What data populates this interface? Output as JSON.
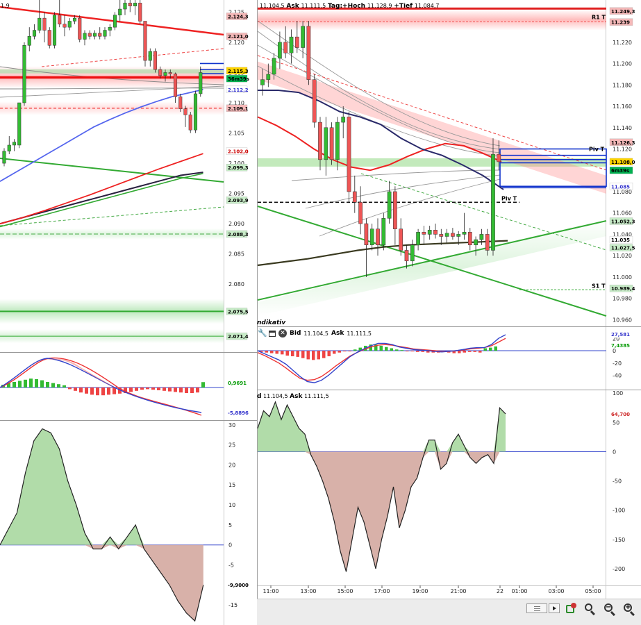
{
  "left_header": "1,9",
  "right_header": {
    "bid_value": "11.104,5",
    "ask_label": "Ask",
    "ask_value": "11.111,5",
    "tag_high_label": "Tag:+Hoch",
    "high_value": "11.128,9",
    "tag_low_label": "+Tief",
    "low_value": "11.084,7"
  },
  "indicator_header": {
    "indikativ": "ndikativ",
    "bid_label": "Bid",
    "bid_value": "11.104,5",
    "ask_label": "Ask",
    "ask_value": "11.111,5"
  },
  "osc_header": {
    "bid_fragment": "d",
    "bid_value": "11.104,5",
    "ask_label": "Ask",
    "ask_value": "11.111,5"
  },
  "chart_data": [
    {
      "type": "candlestick",
      "id": "left-price",
      "y_ticks": [
        "2.125",
        "2.120",
        "2.115",
        "2.110",
        "2.105",
        "2.100",
        "2.095",
        "2.090",
        "2.085",
        "2.080"
      ],
      "ylim": [
        2.069,
        2.127
      ],
      "tags": [
        {
          "text": "2.124,3",
          "value": 2.1243,
          "color": "#f4b8b8",
          "fg": "#000"
        },
        {
          "text": "2.121,0",
          "value": 2.121,
          "color": "#f4b8b8",
          "fg": "#000"
        },
        {
          "text": "2.115,3",
          "value": 2.1153,
          "color": "#ffd400",
          "fg": "#000"
        },
        {
          "text": "36m39s",
          "value": 2.114,
          "color": "#00b050",
          "fg": "#000"
        },
        {
          "text": "2.112,2",
          "value": 2.1122,
          "color": "#ffffff",
          "fg": "#3333cc"
        },
        {
          "text": "2.109,1",
          "value": 2.1091,
          "color": "#f4b8b8",
          "fg": "#000"
        },
        {
          "text": "2.102,0",
          "value": 2.102,
          "color": "#ffffff",
          "fg": "#cc0000"
        },
        {
          "text": "2.099,3",
          "value": 2.0993,
          "color": "#c8ecc8",
          "fg": "#000"
        },
        {
          "text": "2.093,9",
          "value": 2.0939,
          "color": "#c8ecc8",
          "fg": "#000"
        },
        {
          "text": "2.088,3",
          "value": 2.0883,
          "color": "#c8ecc8",
          "fg": "#000"
        },
        {
          "text": "2.075,5",
          "value": 2.0755,
          "color": "#c8ecc8",
          "fg": "#000"
        },
        {
          "text": "2.071,4",
          "value": 2.0714,
          "color": "#c8ecc8",
          "fg": "#000"
        }
      ],
      "candles": [
        [
          2.1,
          2.1025,
          2.0995,
          2.102
        ],
        [
          2.102,
          2.1045,
          2.1015,
          2.103
        ],
        [
          2.103,
          2.104,
          2.102,
          2.1035
        ],
        [
          2.103,
          2.106,
          2.1025,
          2.11
        ],
        [
          2.11,
          2.12,
          2.1095,
          2.1195
        ],
        [
          2.1195,
          2.1225,
          2.1185,
          2.121
        ],
        [
          2.121,
          2.123,
          2.1205,
          2.122
        ],
        [
          2.122,
          2.129,
          2.1215,
          2.124
        ],
        [
          2.124,
          2.125,
          2.12,
          2.122
        ],
        [
          2.122,
          2.1225,
          2.119,
          2.1195
        ],
        [
          2.1195,
          2.125,
          2.119,
          2.1245
        ],
        [
          2.1245,
          2.127,
          2.1225,
          2.123
        ],
        [
          2.123,
          2.1245,
          2.121,
          2.1225
        ],
        [
          2.1225,
          2.124,
          2.122,
          2.1235
        ],
        [
          2.1235,
          2.1245,
          2.123,
          2.124
        ],
        [
          2.124,
          2.1245,
          2.12,
          2.1205
        ],
        [
          2.1205,
          2.122,
          2.1195,
          2.1215
        ],
        [
          2.1215,
          2.122,
          2.1205,
          2.121
        ],
        [
          2.121,
          2.122,
          2.1205,
          2.1215
        ],
        [
          2.1215,
          2.1225,
          2.1205,
          2.121
        ],
        [
          2.121,
          2.1225,
          2.1205,
          2.122
        ],
        [
          2.122,
          2.123,
          2.121,
          2.1225
        ],
        [
          2.1225,
          2.125,
          2.122,
          2.1245
        ],
        [
          2.1245,
          2.127,
          2.1235,
          2.1255
        ],
        [
          2.1255,
          2.127,
          2.1245,
          2.1265
        ],
        [
          2.1265,
          2.127,
          2.125,
          2.126
        ],
        [
          2.126,
          2.127,
          2.1245,
          2.1265
        ],
        [
          2.1265,
          2.127,
          2.123,
          2.1235
        ],
        [
          2.1235,
          2.1235,
          2.116,
          2.117
        ],
        [
          2.117,
          2.119,
          2.116,
          2.1185
        ],
        [
          2.1185,
          2.119,
          2.115,
          2.1155
        ],
        [
          2.1155,
          2.116,
          2.114,
          2.1145
        ],
        [
          2.1145,
          2.1155,
          2.1135,
          2.115
        ],
        [
          2.115,
          2.1155,
          2.114,
          2.1148
        ],
        [
          2.1148,
          2.115,
          2.11,
          2.111
        ],
        [
          2.111,
          2.1115,
          2.1085,
          2.109
        ],
        [
          2.109,
          2.1095,
          2.106,
          2.108
        ],
        [
          2.108,
          2.1085,
          2.105,
          2.1055
        ],
        [
          2.1055,
          2.112,
          2.105,
          2.1115
        ],
        [
          2.1115,
          2.116,
          2.111,
          2.115
        ]
      ],
      "ma_blue": [
        2.097,
        2.0985,
        2.1,
        2.1015,
        2.103,
        2.1045,
        2.106,
        2.1072,
        2.1083,
        2.1093,
        2.1102,
        2.111,
        2.1116,
        2.1122
      ],
      "ma_red": [
        2.09,
        2.091,
        2.0922,
        2.0935,
        2.0948,
        2.0962,
        2.0976,
        2.099,
        2.1003,
        2.1016
      ],
      "ma_dark": [
        2.09,
        2.091,
        2.092,
        2.093,
        2.094,
        2.095,
        2.096,
        2.097,
        2.098,
        2.0985
      ],
      "ma_green": [
        2.0895,
        2.0905,
        2.0915,
        2.0925,
        2.0935,
        2.0945,
        2.0955,
        2.0965,
        2.0975,
        2.0983
      ]
    },
    {
      "type": "bar",
      "id": "left-macd",
      "tags": [
        {
          "text": "0,9691",
          "value": 0.9691,
          "color": "#ffffff",
          "fg": "#009900"
        },
        {
          "text": "-5,8896",
          "value": -5.8896,
          "color": "#ffffff",
          "fg": "#3333cc"
        }
      ],
      "values": [
        0.5,
        0.8,
        1.0,
        1.2,
        1.4,
        1.6,
        1.5,
        1.3,
        1.0,
        0.8,
        0.6,
        0.4,
        -0.3,
        -0.6,
        -0.9,
        -1.1,
        -1.3,
        -1.4,
        -1.4,
        -1.3,
        -1.2,
        -1.1,
        -1.0,
        -0.8,
        -0.6,
        -0.4,
        -0.3,
        -0.4,
        -0.5,
        -0.6,
        -0.7,
        -0.8,
        -0.9,
        -1.0,
        -1.0,
        -0.9,
        0.9691
      ]
    },
    {
      "type": "area",
      "id": "left-osc",
      "y_ticks": [
        "30",
        "25",
        "20",
        "15",
        "10",
        "5",
        "0",
        "-5",
        "-10",
        "-15"
      ],
      "ylim": [
        -20,
        31
      ],
      "tag": {
        "text": "-9,9000",
        "value": -9.9
      },
      "values": [
        0,
        4,
        8,
        18,
        26,
        29,
        28,
        24,
        16,
        10,
        3,
        -1,
        -1,
        2,
        -1,
        2,
        5,
        -1,
        -4,
        -7,
        -10,
        -14,
        -17,
        -19,
        -10
      ]
    },
    {
      "type": "candlestick",
      "id": "right-price",
      "y_ticks": [
        "11.220",
        "11.200",
        "11.180",
        "11.160",
        "11.140",
        "11.120",
        "11.100",
        "11.080",
        "11.060",
        "11.040",
        "11.020",
        "11.000",
        "10.980",
        "10.960"
      ],
      "ylim": [
        10.955,
        11.257
      ],
      "x_ticks": [
        "11:00",
        "13:00",
        "15:00",
        "17:00",
        "19:00",
        "21:00",
        "22",
        "01:00",
        "03:00",
        "05:00"
      ],
      "tags": [
        {
          "text": "11.249,3",
          "value": 11.2493,
          "color": "#f4b8b8",
          "fg": "#000"
        },
        {
          "text": "11.239",
          "value": 11.239,
          "color": "#f4b8b8",
          "fg": "#000"
        },
        {
          "text": "11.126,3",
          "value": 11.1263,
          "color": "#f4b8b8",
          "fg": "#000"
        },
        {
          "text": "11.108,0",
          "value": 11.108,
          "color": "#ffd400",
          "fg": "#000"
        },
        {
          "text": "6m39s",
          "value": 11.1,
          "color": "#00b050",
          "fg": "#000"
        },
        {
          "text": "11.085",
          "value": 11.085,
          "color": "#ffffff",
          "fg": "#3333cc"
        },
        {
          "text": "11.052,3",
          "value": 11.0523,
          "color": "#c8ecc8",
          "fg": "#000"
        },
        {
          "text": "11.035",
          "value": 11.035,
          "color": "#ffffff",
          "fg": "#000"
        },
        {
          "text": "11.027,5",
          "value": 11.0275,
          "color": "#c8ecc8",
          "fg": "#000"
        },
        {
          "text": "10.989,4",
          "value": 10.9894,
          "color": "#c8ecc8",
          "fg": "#000"
        }
      ],
      "levels": [
        {
          "name": "R1 T",
          "value": 11.239
        },
        {
          "name": "Piv T",
          "value": 11.07
        },
        {
          "name": "S1 T",
          "value": 10.988
        }
      ],
      "candles": [
        [
          11.18,
          11.195,
          11.17,
          11.185
        ],
        [
          11.185,
          11.2,
          11.178,
          11.19
        ],
        [
          11.19,
          11.21,
          11.185,
          11.205
        ],
        [
          11.205,
          11.23,
          11.195,
          11.22
        ],
        [
          11.22,
          11.235,
          11.205,
          11.21
        ],
        [
          11.21,
          11.232,
          11.2,
          11.225
        ],
        [
          11.225,
          11.24,
          11.21,
          11.215
        ],
        [
          11.215,
          11.24,
          11.205,
          11.235
        ],
        [
          11.235,
          11.24,
          11.18,
          11.185
        ],
        [
          11.185,
          11.19,
          11.14,
          11.145
        ],
        [
          11.145,
          11.15,
          11.1,
          11.11
        ],
        [
          11.11,
          11.15,
          11.095,
          11.14
        ],
        [
          11.14,
          11.145,
          11.105,
          11.11
        ],
        [
          11.11,
          11.15,
          11.1,
          11.145
        ],
        [
          11.145,
          11.16,
          11.13,
          11.15
        ],
        [
          11.15,
          11.155,
          11.07,
          11.08
        ],
        [
          11.08,
          11.095,
          11.06,
          11.07
        ],
        [
          11.07,
          11.085,
          11.04,
          11.05
        ],
        [
          11.05,
          11.055,
          11.0,
          11.03
        ],
        [
          11.03,
          11.05,
          11.025,
          11.045
        ],
        [
          11.045,
          11.055,
          11.02,
          11.03
        ],
        [
          11.03,
          11.06,
          11.025,
          11.055
        ],
        [
          11.055,
          11.09,
          11.05,
          11.08
        ],
        [
          11.08,
          11.085,
          11.03,
          11.045
        ],
        [
          11.045,
          11.055,
          11.02,
          11.025
        ],
        [
          11.025,
          11.03,
          11.008,
          11.015
        ],
        [
          11.015,
          11.035,
          11.01,
          11.03
        ],
        [
          11.03,
          11.045,
          11.025,
          11.042
        ],
        [
          11.042,
          11.048,
          11.03,
          11.04
        ],
        [
          11.04,
          11.048,
          11.035,
          11.044
        ],
        [
          11.044,
          11.05,
          11.036,
          11.04
        ],
        [
          11.04,
          11.045,
          11.03,
          11.038
        ],
        [
          11.038,
          11.045,
          11.032,
          11.041
        ],
        [
          11.041,
          11.046,
          11.035,
          11.038
        ],
        [
          11.038,
          11.043,
          11.03,
          11.04
        ],
        [
          11.04,
          11.06,
          11.035,
          11.042
        ],
        [
          11.042,
          11.046,
          11.025,
          11.03
        ],
        [
          11.03,
          11.038,
          11.02,
          11.035
        ],
        [
          11.035,
          11.045,
          11.03,
          11.04
        ],
        [
          11.04,
          11.045,
          11.02,
          11.025
        ],
        [
          11.025,
          11.13,
          11.02,
          11.115
        ],
        [
          11.115,
          11.128,
          11.1,
          11.108
        ]
      ],
      "ma_red": [
        11.15,
        11.142,
        11.132,
        11.12,
        11.11,
        11.103,
        11.1,
        11.105,
        11.113,
        11.12,
        11.125,
        11.123,
        11.116,
        11.108
      ],
      "ma_navy": [
        11.175,
        11.175,
        11.173,
        11.165,
        11.155,
        11.15,
        11.143,
        11.13,
        11.12,
        11.114,
        11.105,
        11.095,
        11.082
      ],
      "ma_dark": [
        11.011,
        11.014,
        11.017,
        11.021,
        11.025,
        11.028,
        11.03,
        11.031,
        11.032,
        11.033,
        11.034
      ]
    },
    {
      "type": "bar",
      "id": "right-macd",
      "y_ticks": [
        "20",
        "0",
        "-20",
        "-40"
      ],
      "ylim": [
        -62,
        35
      ],
      "tags": [
        {
          "text": "27,581",
          "value": 27.581,
          "color": "#ffffff",
          "fg": "#3333cc"
        },
        {
          "text": "7,4385",
          "value": 7.4385,
          "color": "#ffffff",
          "fg": "#009900"
        }
      ],
      "values": [
        -2,
        -3,
        -4,
        -5,
        -6,
        -8,
        -9,
        -10,
        -12,
        -14,
        -15,
        -14,
        -12,
        -9,
        -5,
        -3,
        -1,
        0,
        2,
        5,
        8,
        10,
        10,
        8,
        6,
        4,
        2,
        1,
        0,
        -1,
        -2,
        -2,
        -3,
        -3,
        -3,
        -2,
        -3,
        -4,
        -4,
        -3,
        -2,
        -2,
        -3,
        4,
        5,
        7
      ],
      "macd_line": [
        0,
        -5,
        -10,
        -15,
        -22,
        -32,
        -42,
        -50,
        -52,
        -48,
        -40,
        -30,
        -20,
        -10,
        -3,
        3,
        8,
        12,
        12,
        10,
        6,
        4,
        2,
        1,
        0,
        -1,
        -2,
        -1,
        0,
        2,
        4,
        5,
        5,
        10,
        20,
        26
      ],
      "signal_line": [
        -3,
        -8,
        -14,
        -20,
        -28,
        -37,
        -45,
        -48,
        -47,
        -42,
        -34,
        -25,
        -17,
        -9,
        -3,
        2,
        6,
        9,
        10,
        9,
        7,
        5,
        3,
        2,
        1,
        0,
        -1,
        -1,
        0,
        1,
        3,
        4,
        5,
        8,
        14,
        20
      ]
    },
    {
      "type": "area",
      "id": "right-osc",
      "y_ticks": [
        "100",
        "50",
        "0",
        "-50",
        "-100",
        "-150",
        "-200"
      ],
      "ylim": [
        -225,
        105
      ],
      "tag": {
        "text": "64,700",
        "value": 64.7
      },
      "values": [
        40,
        70,
        60,
        85,
        55,
        80,
        60,
        40,
        30,
        -5,
        -25,
        -50,
        -80,
        -120,
        -170,
        -205,
        -150,
        -95,
        -120,
        -160,
        -200,
        -150,
        -110,
        -60,
        -130,
        -100,
        -60,
        -45,
        -10,
        20,
        20,
        -30,
        -20,
        15,
        30,
        10,
        -10,
        -20,
        -10,
        -5,
        -20,
        75,
        64.7
      ]
    }
  ]
}
